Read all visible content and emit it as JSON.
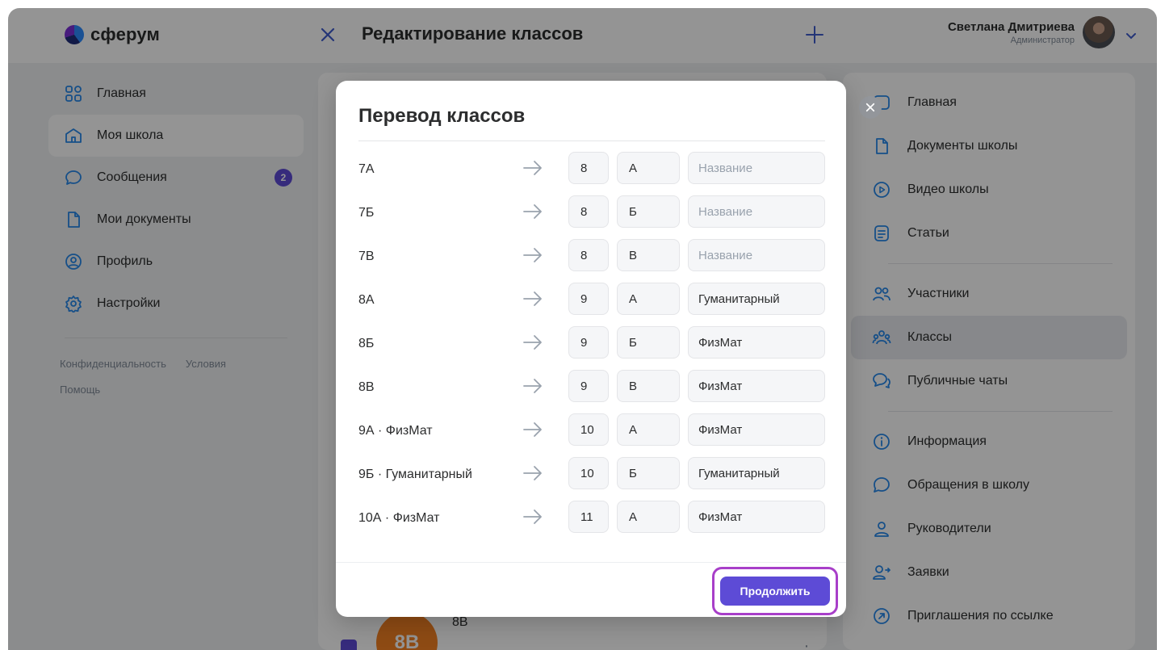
{
  "header": {
    "logo_text": "сферум",
    "title": "Редактирование классов",
    "user_name": "Светлана Дмитриева",
    "user_role": "Администратор"
  },
  "left_nav": {
    "items": [
      {
        "label": "Главная",
        "icon": "grid-icon"
      },
      {
        "label": "Моя школа",
        "icon": "school-icon",
        "active": true
      },
      {
        "label": "Сообщения",
        "icon": "message-icon",
        "badge": "2"
      },
      {
        "label": "Мои документы",
        "icon": "document-icon"
      },
      {
        "label": "Профиль",
        "icon": "profile-icon"
      },
      {
        "label": "Настройки",
        "icon": "gear-icon"
      }
    ],
    "footer": {
      "privacy": "Конфиденциальность",
      "terms": "Условия",
      "help": "Помощь"
    }
  },
  "right_nav": {
    "items": [
      {
        "label": "Главная",
        "icon": "home-icon"
      },
      {
        "label": "Документы школы",
        "icon": "document-icon"
      },
      {
        "label": "Видео школы",
        "icon": "play-icon"
      },
      {
        "label": "Статьи",
        "icon": "article-icon"
      },
      {
        "label": "Участники",
        "icon": "members-icon"
      },
      {
        "label": "Классы",
        "icon": "classes-icon",
        "active": true
      },
      {
        "label": "Публичные чаты",
        "icon": "chats-icon"
      },
      {
        "label": "Информация",
        "icon": "info-icon"
      },
      {
        "label": "Обращения в школу",
        "icon": "message-icon"
      },
      {
        "label": "Руководители",
        "icon": "person-icon"
      },
      {
        "label": "Заявки",
        "icon": "requests-icon"
      },
      {
        "label": "Приглашения по ссылке",
        "icon": "link-icon"
      }
    ]
  },
  "background_row": {
    "avatar_text": "8В",
    "label": "8В"
  },
  "modal": {
    "title": "Перевод классов",
    "name_placeholder": "Название",
    "rows": [
      {
        "from": "7А",
        "grade": "8",
        "letter": "А",
        "name": ""
      },
      {
        "from": "7Б",
        "grade": "8",
        "letter": "Б",
        "name": ""
      },
      {
        "from": "7В",
        "grade": "8",
        "letter": "В",
        "name": ""
      },
      {
        "from": "8А",
        "grade": "9",
        "letter": "А",
        "name": "Гуманитарный"
      },
      {
        "from": "8Б",
        "grade": "9",
        "letter": "Б",
        "name": "ФизМат"
      },
      {
        "from": "8В",
        "grade": "9",
        "letter": "В",
        "name": "ФизМат"
      },
      {
        "from": "9А · ФизМат",
        "grade": "10",
        "letter": "А",
        "name": "ФизМат"
      },
      {
        "from": "9Б · Гуманитарный",
        "grade": "10",
        "letter": "Б",
        "name": "Гуманитарный"
      },
      {
        "from": "10А · ФизМат",
        "grade": "11",
        "letter": "А",
        "name": "ФизМат"
      }
    ],
    "continue_label": "Продолжить"
  },
  "colors": {
    "accent": "#5d4bd6",
    "highlight_outline": "#a83fc9",
    "icon": "#2688eb",
    "avatar_orange": "#f58224"
  }
}
